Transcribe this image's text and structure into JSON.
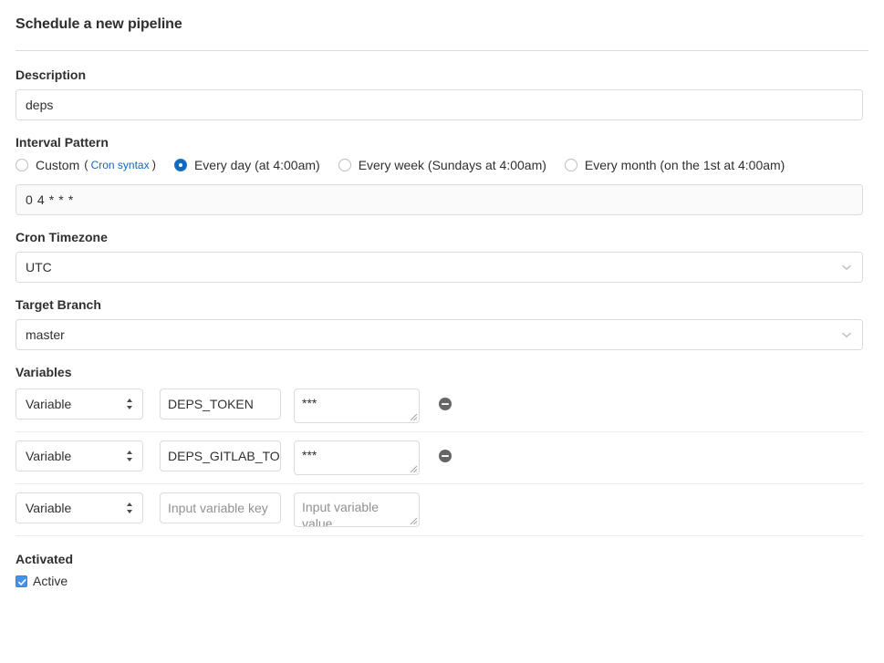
{
  "header": {
    "title": "Schedule a new pipeline"
  },
  "description": {
    "label": "Description",
    "value": "deps",
    "placeholder": ""
  },
  "interval": {
    "label": "Interval Pattern",
    "options": [
      {
        "label": "Custom",
        "link_text": "Cron syntax",
        "open_paren": "(",
        "close_paren": ")",
        "selected": false
      },
      {
        "label": "Every day (at 4:00am)",
        "selected": true
      },
      {
        "label": "Every week (Sundays at 4:00am)",
        "selected": false
      },
      {
        "label": "Every month (on the 1st at 4:00am)",
        "selected": false
      }
    ],
    "cron_value": "0 4 * * *"
  },
  "timezone": {
    "label": "Cron Timezone",
    "value": "UTC"
  },
  "branch": {
    "label": "Target Branch",
    "value": "master"
  },
  "variables": {
    "label": "Variables",
    "rows": [
      {
        "type": "Variable",
        "key": "DEPS_TOKEN",
        "key_placeholder": "",
        "value": "***",
        "value_placeholder": "",
        "removable": true
      },
      {
        "type": "Variable",
        "key": "DEPS_GITLAB_TOKEN",
        "key_placeholder": "",
        "value": "***",
        "value_placeholder": "",
        "removable": true
      },
      {
        "type": "Variable",
        "key": "",
        "key_placeholder": "Input variable key",
        "value": "",
        "value_placeholder": "Input variable value",
        "removable": false
      }
    ]
  },
  "activated": {
    "label": "Activated",
    "checkbox_label": "Active",
    "checked": true
  },
  "colors": {
    "accent": "#1068bf",
    "link": "#1068bf",
    "text": "#303030",
    "border": "#dbdbdb",
    "muted": "#919191",
    "checkbox": "#4a90e8"
  }
}
